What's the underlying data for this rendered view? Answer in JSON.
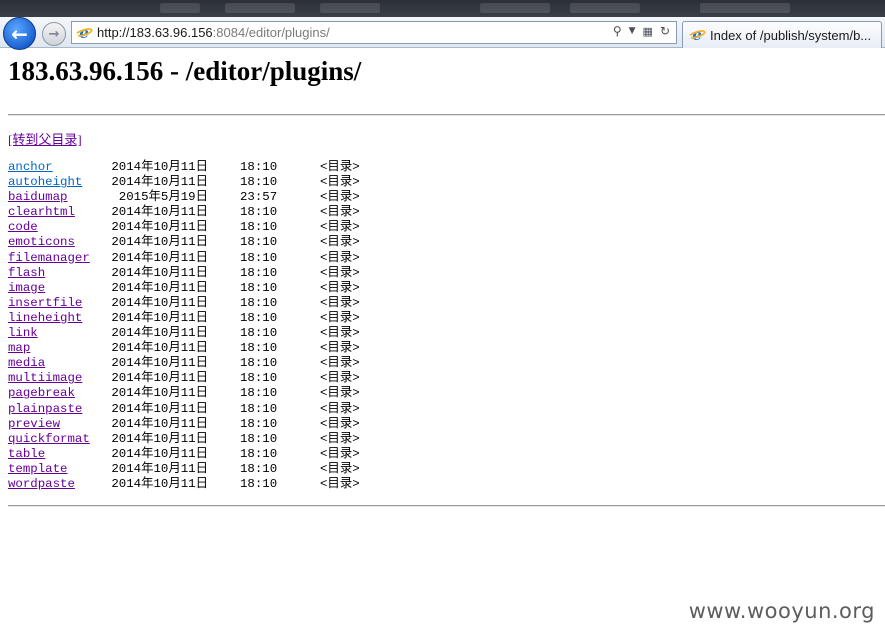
{
  "browser": {
    "address_host": "http://183.63.96.156",
    "address_rest": ":8084/editor/plugins/",
    "tab_title": "Index of /publish/system/b..."
  },
  "page": {
    "title": "183.63.96.156 - /editor/plugins/",
    "parent_link": "[转到父目录]",
    "entries": [
      {
        "date": "2014年10月11日",
        "time": "18:10",
        "type": "<目录>",
        "name": "anchor",
        "visited": false
      },
      {
        "date": "2014年10月11日",
        "time": "18:10",
        "type": "<目录>",
        "name": "autoheight",
        "visited": false
      },
      {
        "date": "2015年5月19日",
        "time": "23:57",
        "type": "<目录>",
        "name": "baidumap",
        "visited": true
      },
      {
        "date": "2014年10月11日",
        "time": "18:10",
        "type": "<目录>",
        "name": "clearhtml",
        "visited": true
      },
      {
        "date": "2014年10月11日",
        "time": "18:10",
        "type": "<目录>",
        "name": "code",
        "visited": true
      },
      {
        "date": "2014年10月11日",
        "time": "18:10",
        "type": "<目录>",
        "name": "emoticons",
        "visited": true
      },
      {
        "date": "2014年10月11日",
        "time": "18:10",
        "type": "<目录>",
        "name": "filemanager",
        "visited": true
      },
      {
        "date": "2014年10月11日",
        "time": "18:10",
        "type": "<目录>",
        "name": "flash",
        "visited": true
      },
      {
        "date": "2014年10月11日",
        "time": "18:10",
        "type": "<目录>",
        "name": "image",
        "visited": true
      },
      {
        "date": "2014年10月11日",
        "time": "18:10",
        "type": "<目录>",
        "name": "insertfile",
        "visited": true
      },
      {
        "date": "2014年10月11日",
        "time": "18:10",
        "type": "<目录>",
        "name": "lineheight",
        "visited": true
      },
      {
        "date": "2014年10月11日",
        "time": "18:10",
        "type": "<目录>",
        "name": "link",
        "visited": true
      },
      {
        "date": "2014年10月11日",
        "time": "18:10",
        "type": "<目录>",
        "name": "map",
        "visited": true
      },
      {
        "date": "2014年10月11日",
        "time": "18:10",
        "type": "<目录>",
        "name": "media",
        "visited": true
      },
      {
        "date": "2014年10月11日",
        "time": "18:10",
        "type": "<目录>",
        "name": "multiimage",
        "visited": true
      },
      {
        "date": "2014年10月11日",
        "time": "18:10",
        "type": "<目录>",
        "name": "pagebreak",
        "visited": true
      },
      {
        "date": "2014年10月11日",
        "time": "18:10",
        "type": "<目录>",
        "name": "plainpaste",
        "visited": true
      },
      {
        "date": "2014年10月11日",
        "time": "18:10",
        "type": "<目录>",
        "name": "preview",
        "visited": true
      },
      {
        "date": "2014年10月11日",
        "time": "18:10",
        "type": "<目录>",
        "name": "quickformat",
        "visited": true
      },
      {
        "date": "2014年10月11日",
        "time": "18:10",
        "type": "<目录>",
        "name": "table",
        "visited": true
      },
      {
        "date": "2014年10月11日",
        "time": "18:10",
        "type": "<目录>",
        "name": "template",
        "visited": true
      },
      {
        "date": "2014年10月11日",
        "time": "18:10",
        "type": "<目录>",
        "name": "wordpaste",
        "visited": true
      }
    ]
  },
  "watermark": "www.wooyun.org",
  "colors": {
    "link_visited": "#660099",
    "link_unvisited": "#0066cc"
  }
}
